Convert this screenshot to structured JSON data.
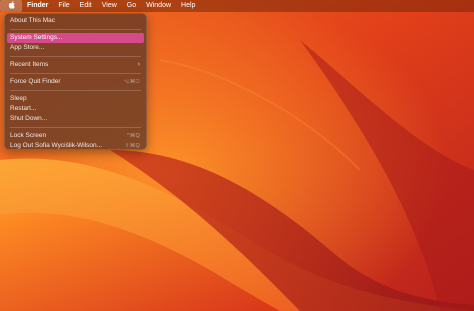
{
  "menubar": {
    "items": [
      "Finder",
      "File",
      "Edit",
      "View",
      "Go",
      "Window",
      "Help"
    ]
  },
  "apple_menu": {
    "about": "About This Mac",
    "system_settings": "System Settings...",
    "app_store": "App Store...",
    "recent_items": "Recent Items",
    "force_quit": "Force Quit Finder",
    "force_quit_shortcut": "⌥⌘⎋",
    "sleep": "Sleep",
    "restart": "Restart...",
    "shut_down": "Shut Down...",
    "lock_screen": "Lock Screen",
    "lock_screen_shortcut": "^⌘Q",
    "log_out": "Log Out Sofia Wyciślik-Wilson...",
    "log_out_shortcut": "⇧⌘Q"
  },
  "colors": {
    "highlight": "#d64a8c",
    "wallpaper_base": "#e8471b"
  }
}
